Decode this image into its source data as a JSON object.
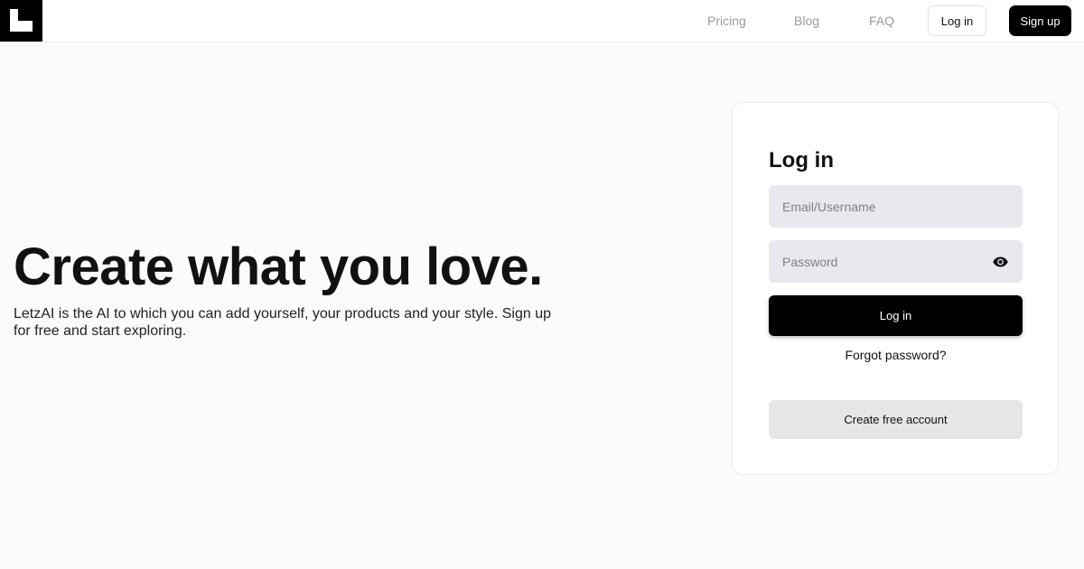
{
  "header": {
    "logo_icon": "letzai-logo-icon",
    "nav": {
      "pricing": "Pricing",
      "blog": "Blog",
      "faq": "FAQ"
    },
    "login_label": "Log in",
    "signup_label": "Sign up"
  },
  "hero": {
    "title": "Create what you love.",
    "subtitle": "LetzAI is the AI to which you can add yourself, your products and your style. Sign up for free and start exploring."
  },
  "login_card": {
    "title": "Log in",
    "email_placeholder": "Email/Username",
    "password_placeholder": "Password",
    "password_toggle_icon": "eye-icon",
    "submit_label": "Log in",
    "forgot_label": "Forgot password?",
    "create_account_label": "Create free account"
  },
  "colors": {
    "brand": "#000000",
    "input_bg": "#e8e9ee",
    "secondary_button": "#e6e6e6",
    "page_bg": "#fbfbfb"
  }
}
